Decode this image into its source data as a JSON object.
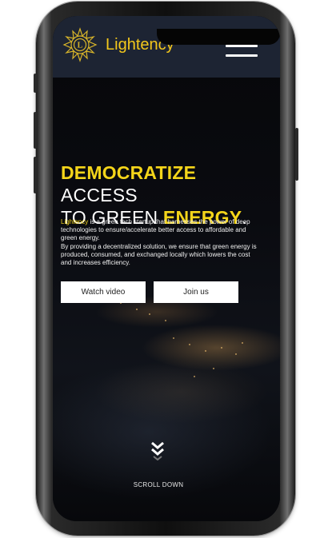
{
  "navbar": {
    "brand": "Lightency",
    "logo_icon": "sun-emblem-icon",
    "menu_icon": "hamburger-menu-icon"
  },
  "hero": {
    "headline": {
      "line1_accent": "DEMOCRATIZE",
      "line1_rest": " ACCESS",
      "line2_start": "TO GREEN ",
      "line2_accent": "ENERGY",
      "line2_end": "."
    },
    "description": {
      "brand": "Lightency",
      "text1": " is a green tech startup that harnesses the power of deep technologies to ensure/accelerate better access to affordable and green energy.",
      "text2": "By providing a decentralized solution, we ensure that green energy is produced, consumed, and exchanged locally which lowers the cost and increases efficiency."
    },
    "buttons": {
      "watch_video": "Watch video",
      "join_us": "Join us"
    },
    "scroll": {
      "label": "SCROLL DOWN",
      "icon": "chevron-double-down-icon"
    }
  },
  "colors": {
    "accent": "#f4d51a",
    "navbar_bg": "#1d2433",
    "background": "#07080c"
  }
}
